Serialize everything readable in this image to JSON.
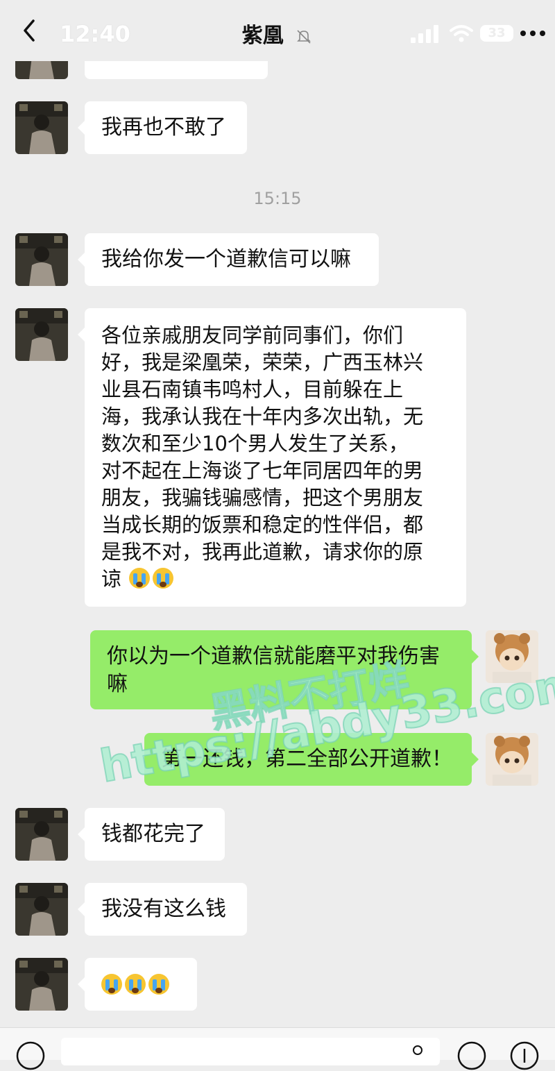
{
  "status_bar": {
    "time": "12:40",
    "battery": "33"
  },
  "header": {
    "title": "紫凰",
    "muted": true
  },
  "timestamp": "15:15",
  "messages": [
    {
      "side": "left",
      "text": "我再也不敢了"
    },
    {
      "side": "left",
      "text": "我给你发一个道歉信可以嘛"
    },
    {
      "side": "left",
      "lines": [
        "各位亲戚朋友同学前同事们，你们",
        "好，我是梁凰荣，荣荣，广西玉林兴",
        "业县石南镇韦鸣村人，目前躲在上",
        "海，我承认我在十年内多次出轨，无",
        "数次和至少10个男人发生了关系，",
        "对不起在上海谈了七年同居四年的男",
        "朋友，我骗钱骗感情，把这个男朋友",
        "当成长期的饭票和稳定的性伴侣，都",
        "是我不对，我再此道歉，请求你的原",
        "谅"
      ],
      "emoji_count": 2
    },
    {
      "side": "right",
      "lines": [
        "你以为一个道歉信就能磨平对我伤害",
        "嘛"
      ]
    },
    {
      "side": "right",
      "text": "第一还钱，第二全部公开道歉！"
    },
    {
      "side": "left",
      "text": "钱都花完了"
    },
    {
      "side": "left",
      "text": "我没有这么钱"
    },
    {
      "side": "left",
      "emoji_count": 3
    }
  ],
  "watermark": {
    "line1": "黑料不打烊",
    "line2": "https://abdy33.com"
  },
  "colors": {
    "background": "#ededed",
    "self_bubble": "#95ec69",
    "other_bubble": "#ffffff"
  }
}
